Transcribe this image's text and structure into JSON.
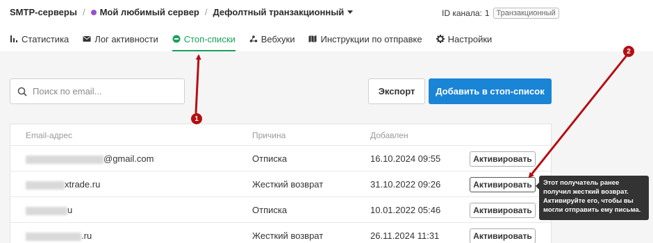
{
  "breadcrumb": {
    "root": "SMTP-серверы",
    "separator": "/",
    "server": "Мой любимый сервер",
    "current": "Дефолтный транзакционный"
  },
  "channel": {
    "label": "ID канала:",
    "value": "1",
    "badge": "Транзакционный"
  },
  "tabs": [
    {
      "label": "Статистика",
      "icon": "bar-chart-icon",
      "active": false
    },
    {
      "label": "Лог активности",
      "icon": "envelope-icon",
      "active": false
    },
    {
      "label": "Стоп-списки",
      "icon": "minus-circle-icon",
      "active": true
    },
    {
      "label": "Вебхуки",
      "icon": "webhook-icon",
      "active": false
    },
    {
      "label": "Инструкции по отправке",
      "icon": "map-icon",
      "active": false
    },
    {
      "label": "Настройки",
      "icon": "gear-icon",
      "active": false
    }
  ],
  "search": {
    "placeholder": "Поиск по email...",
    "value": ""
  },
  "toolbar": {
    "export_label": "Экспорт",
    "add_label": "Добавить в стоп-список"
  },
  "table": {
    "columns": [
      "Email-адрес",
      "Причина",
      "Добавлен"
    ],
    "rows": [
      {
        "email": "@gmail.com",
        "reason": "Отписка",
        "added": "16.10.2024 09:55",
        "action": "Активировать"
      },
      {
        "email": "xtrade.ru",
        "reason": "Жесткий возврат",
        "added": "31.10.2022 09:26",
        "action": "Активировать"
      },
      {
        "email": "u",
        "reason": "Отписка",
        "added": "10.01.2022 05:46",
        "action": "Активировать"
      },
      {
        "email": ".ru",
        "reason": "Жесткий возврат",
        "added": "26.11.2024 11:31",
        "action": "Активировать"
      }
    ]
  },
  "tooltip": {
    "text": "Этот получатель ранее получил жесткий возврат. Активируйте его, чтобы вы могли отправить ему письма."
  },
  "annotations": {
    "marker1": "1",
    "marker2": "2"
  },
  "colors": {
    "accent_green": "#1aa05a",
    "primary_blue": "#1a84d6",
    "annotation_red": "#b40f13",
    "server_dot": "#9a4fd0"
  }
}
